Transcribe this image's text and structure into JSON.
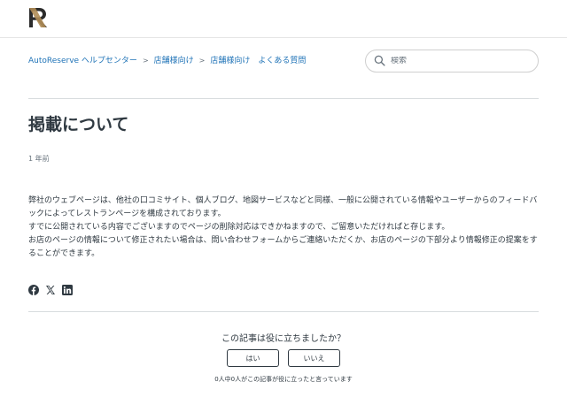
{
  "header": {
    "logo_icon": "autoreserve-logo-icon",
    "logo_colors": {
      "dark": "#2b2b2b",
      "gold": "#b08d57"
    }
  },
  "breadcrumb": [
    {
      "label": "AutoReserve ヘルプセンター"
    },
    {
      "label": "店舗様向け"
    },
    {
      "label": "店舗様向け　よくある質問"
    }
  ],
  "search": {
    "placeholder": "検索",
    "icon": "search-icon"
  },
  "article": {
    "title": "掲載について",
    "meta": "1 年前",
    "paragraphs": [
      "弊社のウェブページは、他社の口コミサイト、個人ブログ、地図サービスなどと同様、一般に公開されている情報やユーザーからのフィードバックによってレストランページを構成されております。",
      "すでに公開されている内容でございますのでページの削除対応はできかねますので、ご留意いただければと存じます。",
      "お店のページの情報について修正されたい場合は、問い合わせフォームからご連絡いただくか、お店のページの下部分より情報修正の提案をすることができます。"
    ]
  },
  "share": {
    "icons": [
      "facebook-icon",
      "x-icon",
      "linkedin-icon"
    ],
    "color": "#2f3941"
  },
  "vote": {
    "question": "この記事は役に立ちましたか？",
    "yes_label": "はい",
    "no_label": "いいえ",
    "count_text": "0人中0人がこの記事が役に立ったと言っています"
  },
  "colors": {
    "link": "#1f73b7",
    "text": "#2f3941",
    "muted": "#68737d"
  }
}
